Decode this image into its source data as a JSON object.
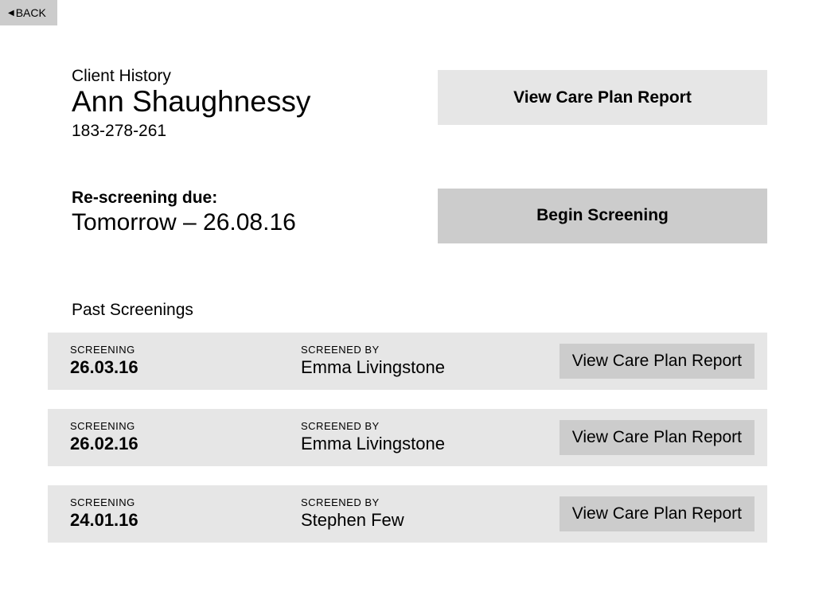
{
  "back": {
    "label": "BACK"
  },
  "client": {
    "history_label": "Client History",
    "name": "Ann Shaughnessy",
    "id": "183-278-261"
  },
  "actions": {
    "view_care_plan": "View Care Plan Report",
    "begin_screening": "Begin Screening"
  },
  "rescreening": {
    "label": "Re-screening due:",
    "date": "Tomorrow – 26.08.16"
  },
  "past": {
    "label": "Past Screenings",
    "screening_label": "SCREENING",
    "screened_by_label": "SCREENED BY",
    "view_report_label": "View Care Plan Report",
    "rows": [
      {
        "date": "26.03.16",
        "by": "Emma Livingstone"
      },
      {
        "date": "26.02.16",
        "by": "Emma Livingstone"
      },
      {
        "date": "24.01.16",
        "by": "Stephen Few"
      }
    ]
  }
}
